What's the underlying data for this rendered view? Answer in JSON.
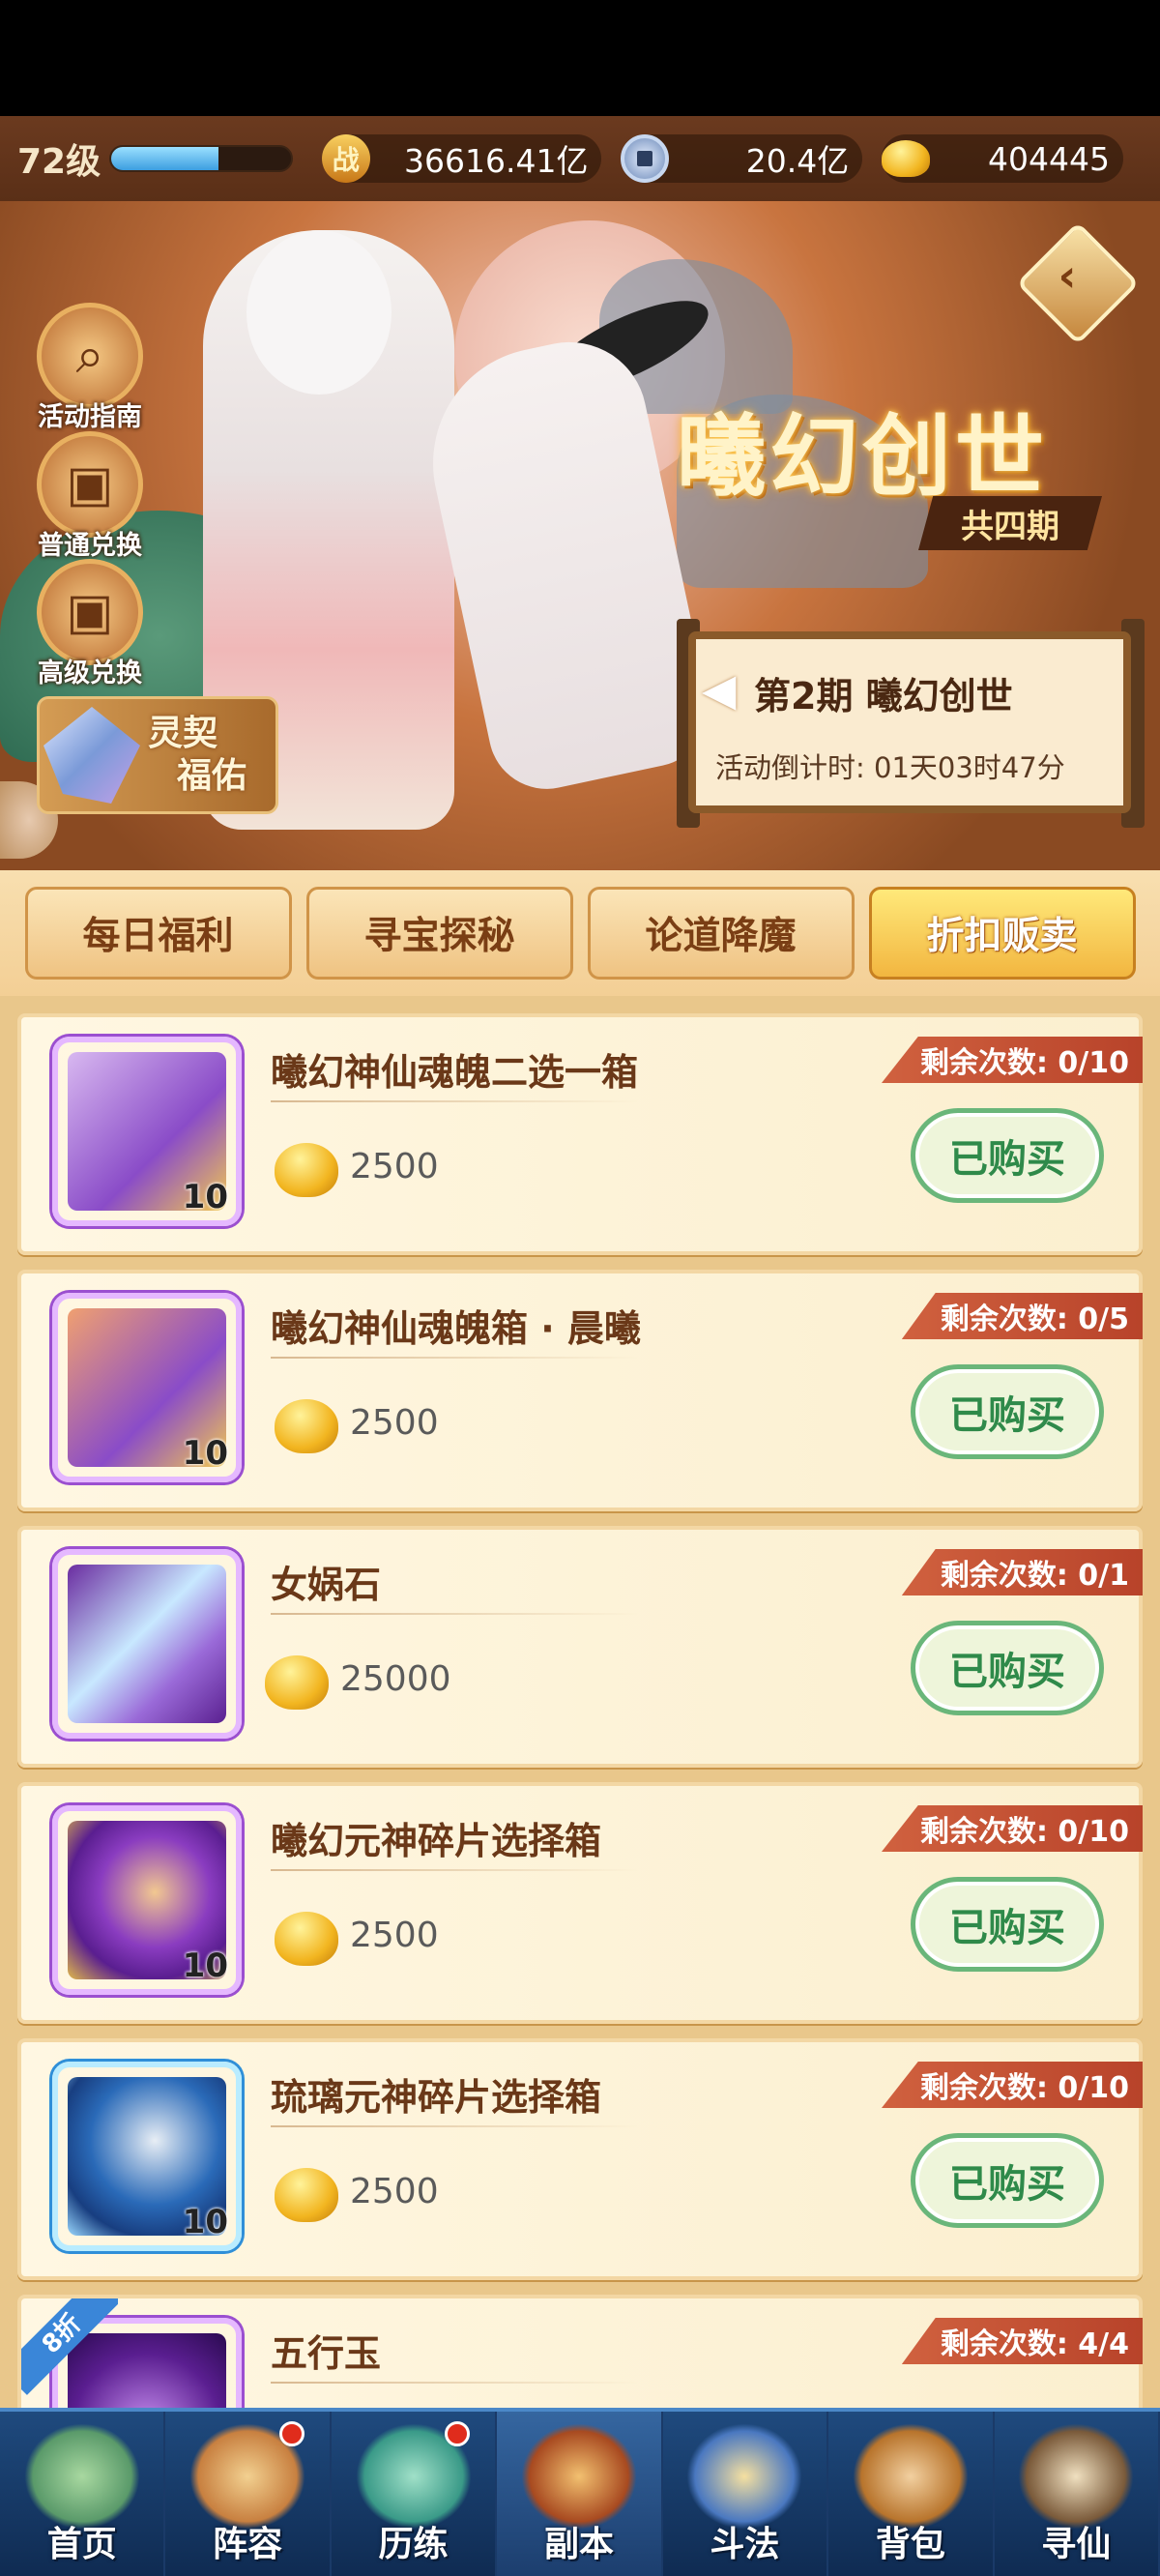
{
  "status": {
    "level": "72级",
    "xp_fraction": 0.6,
    "battle_power_icon": "战",
    "battle_power": "36616.41亿",
    "coin_value": "20.4亿",
    "gold_value": "404445"
  },
  "banner": {
    "title": "曦幻创世",
    "subtitle": "共四期",
    "side_buttons": [
      {
        "label": "活动指南",
        "icon": "magnifier-icon"
      },
      {
        "label": "普通兑换",
        "icon": "gift-box-icon"
      },
      {
        "label": "高级兑换",
        "icon": "gift-box-icon"
      }
    ],
    "lingqi_label_line1": "灵契",
    "lingqi_label_line2": "福佑",
    "period_title": "第2期  曦幻创世",
    "countdown": "活动倒计时: 01天03时47分"
  },
  "tabs": [
    {
      "label": "每日福利",
      "active": false
    },
    {
      "label": "寻宝探秘",
      "active": false
    },
    {
      "label": "论道降魔",
      "active": false
    },
    {
      "label": "折扣贩卖",
      "active": true
    }
  ],
  "items": [
    {
      "name": "曦幻神仙魂魄二选一箱",
      "price": "2500",
      "remain": "剩余次数: 0/10",
      "count": "10",
      "button": "已购买",
      "frame": "purple"
    },
    {
      "name": "曦幻神仙魂魄箱 · 晨曦",
      "price": "2500",
      "remain": "剩余次数: 0/5",
      "count": "10",
      "button": "已购买",
      "frame": "purple"
    },
    {
      "name": "女娲石",
      "price": "25000",
      "remain": "剩余次数: 0/1",
      "count": "",
      "button": "已购买",
      "frame": "purple"
    },
    {
      "name": "曦幻元神碎片选择箱",
      "price": "2500",
      "remain": "剩余次数: 0/10",
      "count": "10",
      "button": "已购买",
      "frame": "purple"
    },
    {
      "name": "琉璃元神碎片选择箱",
      "price": "2500",
      "remain": "剩余次数: 0/10",
      "count": "10",
      "button": "已购买",
      "frame": "blue"
    },
    {
      "name": "五行玉",
      "price": "",
      "remain": "剩余次数: 4/4",
      "count": "",
      "button": "",
      "frame": "purple",
      "sale": "8折"
    }
  ],
  "nav": [
    {
      "label": "首页",
      "dot": false
    },
    {
      "label": "阵容",
      "dot": true
    },
    {
      "label": "历练",
      "dot": true
    },
    {
      "label": "副本",
      "dot": false,
      "active": true
    },
    {
      "label": "斗法",
      "dot": false
    },
    {
      "label": "背包",
      "dot": false
    },
    {
      "label": "寻仙",
      "dot": false
    }
  ],
  "colors": {
    "accent": "#f2b640",
    "remain_badge": "#c0492e",
    "buy_green": "#2f8a4a",
    "nav_bg": "#1f4a7e"
  }
}
